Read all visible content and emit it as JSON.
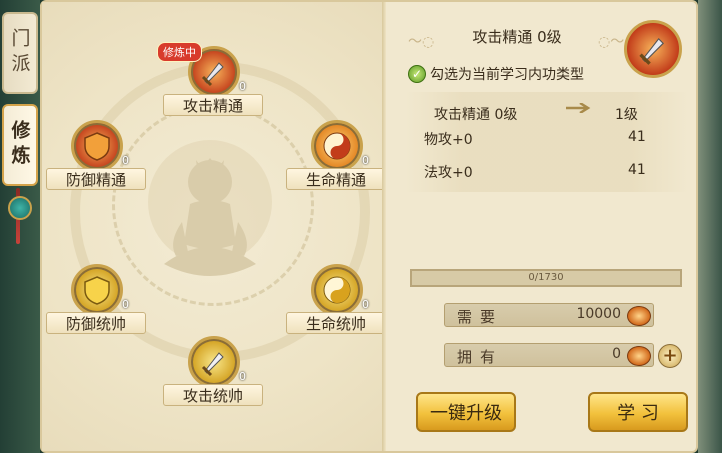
{
  "side_tabs": [
    {
      "label": "门派",
      "active": false
    },
    {
      "label": "修炼",
      "active": true
    }
  ],
  "skills": [
    {
      "name": "攻击精通",
      "level": "0",
      "badge": "修炼中",
      "color": "red",
      "icon": "sword-icon"
    },
    {
      "name": "防御精通",
      "level": "0",
      "color": "red",
      "icon": "shield-icon"
    },
    {
      "name": "生命精通",
      "level": "0",
      "color": "orange",
      "icon": "yin-yang-icon"
    },
    {
      "name": "防御统帅",
      "level": "0",
      "color": "gold",
      "icon": "shield-icon"
    },
    {
      "name": "生命统帅",
      "level": "0",
      "color": "gold",
      "icon": "yin-yang-icon"
    },
    {
      "name": "攻击统帅",
      "level": "0",
      "color": "gold",
      "icon": "sword-icon"
    }
  ],
  "detail": {
    "title": "攻击精通  0级",
    "checkbox_label": "勾选为当前学习内功类型",
    "checked": true,
    "current_level": "攻击精通 0级",
    "next_level": "1级",
    "stats": [
      {
        "label": "物攻+0",
        "next": "41"
      },
      {
        "label": "法攻+0",
        "next": "41"
      }
    ],
    "progress_text": "0/1730",
    "progress_fraction": 0,
    "need_label": "需要",
    "need_value": "10000",
    "have_label": "拥有",
    "have_value": "0"
  },
  "buttons": {
    "upgrade": "一键升级",
    "learn": "学 习"
  },
  "colors": {
    "panel": "#f1e8cf",
    "button": "#f2c13c",
    "badge": "#d83b2c"
  }
}
